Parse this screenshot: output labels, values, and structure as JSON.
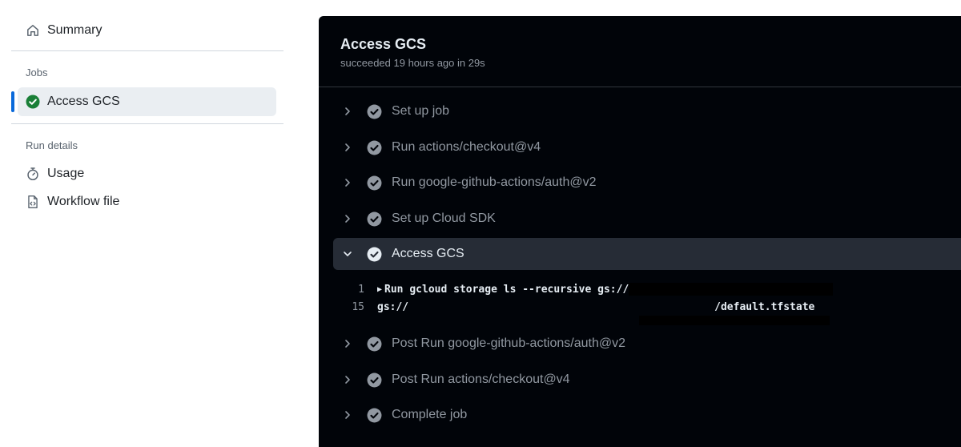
{
  "sidebar": {
    "summary_label": "Summary",
    "jobs_heading": "Jobs",
    "job_label": "Access GCS",
    "run_details_heading": "Run details",
    "usage_label": "Usage",
    "workflow_file_label": "Workflow file"
  },
  "log": {
    "title": "Access GCS",
    "status": "succeeded 19 hours ago in 29s",
    "steps": [
      {
        "label": "Set up job",
        "state": "collapsed"
      },
      {
        "label": "Run actions/checkout@v4",
        "state": "collapsed"
      },
      {
        "label": "Run google-github-actions/auth@v2",
        "state": "collapsed"
      },
      {
        "label": "Set up Cloud SDK",
        "state": "collapsed"
      },
      {
        "label": "Access GCS",
        "state": "expanded"
      },
      {
        "label": "Post Run google-github-actions/auth@v2",
        "state": "collapsed"
      },
      {
        "label": "Post Run actions/checkout@v4",
        "state": "collapsed"
      },
      {
        "label": "Complete job",
        "state": "collapsed"
      }
    ],
    "lines": [
      {
        "number": "1",
        "text": "Run gcloud storage ls --recursive gs://",
        "suffix": ""
      },
      {
        "number": "15",
        "text": "gs://",
        "suffix": "/default.tfstate"
      }
    ]
  },
  "colors": {
    "accent": "#0969da",
    "success": "#1a7f37",
    "log_background": "#010409",
    "expanded_step": "#262c36"
  },
  "icons": [
    "home-icon",
    "check-circle-icon",
    "stopwatch-icon",
    "file-code-icon",
    "chevron-right-icon",
    "chevron-down-icon"
  ]
}
